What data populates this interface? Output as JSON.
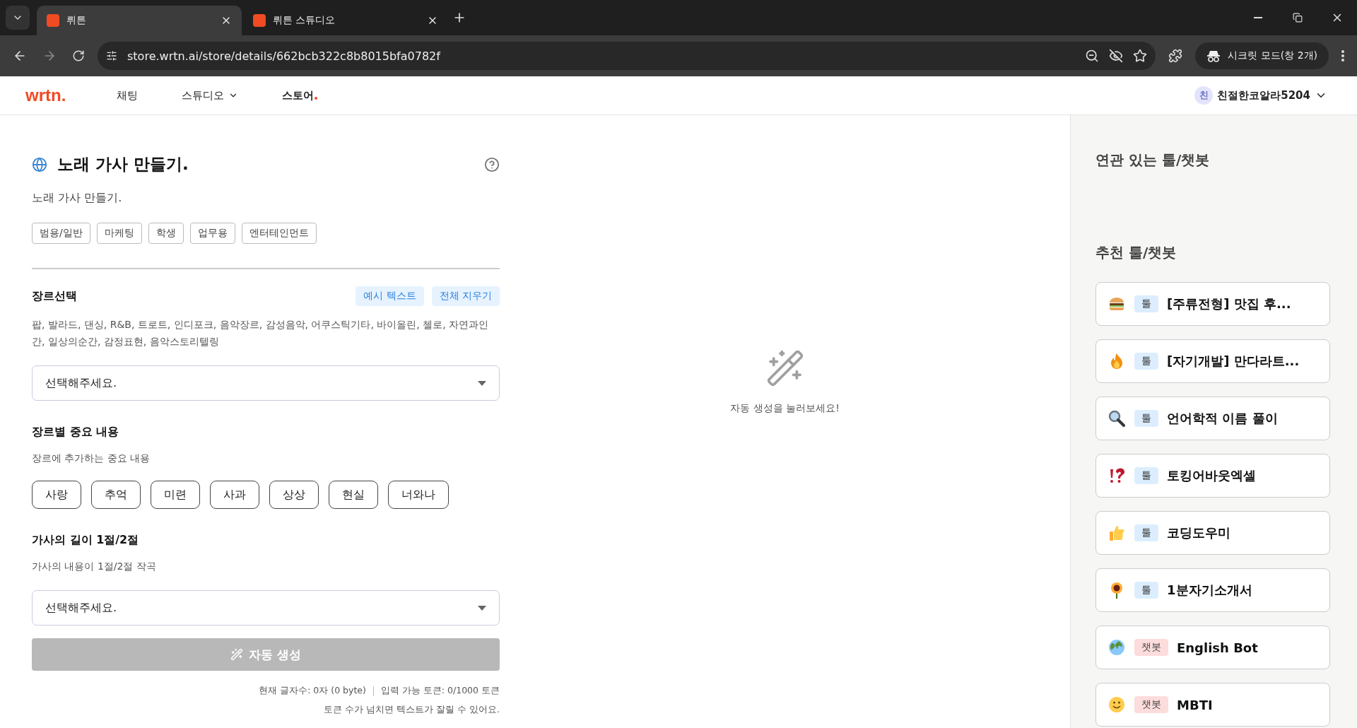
{
  "browser": {
    "tabs": [
      {
        "title": "뤼튼",
        "selected": true
      },
      {
        "title": "뤼튼 스튜디오",
        "selected": false
      }
    ],
    "url": "store.wrtn.ai/store/details/662bcb322c8b8015bfa0782f",
    "profile": "시크릿 모드(창 2개)"
  },
  "nav": {
    "logo": "wrtn.",
    "items": [
      {
        "label": "채팅",
        "selected": false,
        "dropdown": false
      },
      {
        "label": "스튜디오",
        "selected": false,
        "dropdown": true
      },
      {
        "label": "스토어",
        "selected": true,
        "dropdown": false
      }
    ],
    "user": {
      "avatar": "친",
      "name": "친절한코알라5204"
    }
  },
  "tool": {
    "title": "노래 가사 만들기.",
    "description": "노래 가사 만들기.",
    "tags": [
      "범용/일반",
      "마케팅",
      "학생",
      "업무용",
      "엔터테인먼트"
    ],
    "fields": [
      {
        "kind": "select",
        "label": "장르선택",
        "actions": [
          "예시 텍스트",
          "전체 지우기"
        ],
        "hint": "팝, 발라드, 댄싱, R&B, 트로트, 인디포크, 음악장르, 감성음악, 어쿠스틱기타, 바이올린, 첼로, 자연과인간, 일상의순간, 감정표현, 음악스토리텔링",
        "placeholder": "선택해주세요."
      },
      {
        "kind": "chips",
        "label": "장르별 중요 내용",
        "hint": "장르에 추가하는 중요 내용",
        "options": [
          {
            "label": "사랑",
            "selected": false
          },
          {
            "label": "추억",
            "selected": false
          },
          {
            "label": "미련",
            "selected": false
          },
          {
            "label": "사과",
            "selected": false
          },
          {
            "label": "상상",
            "selected": false
          },
          {
            "label": "현실",
            "selected": false
          },
          {
            "label": "너와나",
            "selected": false
          }
        ]
      },
      {
        "kind": "select",
        "label": "가사의 길이 1절/2절",
        "hint": "가사의 내용이 1절/2절 작곡",
        "placeholder": "선택해주세요."
      }
    ],
    "generate": {
      "label": "자동 생성",
      "disabled": true
    },
    "counter": "현재 글자수: 0자 (0 byte)",
    "tokens": "입력 가능 토큰: 0/1000 토큰",
    "warning": "토큰 수가 넘치면 텍스트가 잘릴 수 있어요."
  },
  "result": {
    "empty_message": "자동 생성을 눌러보세요!"
  },
  "sidebar": {
    "related_title": "연관 있는 툴/챗봇",
    "recommended_title": "추천 툴/챗봇",
    "items": [
      {
        "kind": "tool",
        "badge": "툴",
        "title": "[주류전형] 맛집 후..."
      },
      {
        "kind": "tool",
        "badge": "툴",
        "title": "[자기개발] 만다라트..."
      },
      {
        "kind": "tool",
        "badge": "툴",
        "title": "언어학적 이름 풀이"
      },
      {
        "kind": "tool",
        "badge": "툴",
        "title": "토킹어바웃엑셀"
      },
      {
        "kind": "tool",
        "badge": "툴",
        "title": "코딩도우미"
      },
      {
        "kind": "tool",
        "badge": "툴",
        "title": "1분자기소개서"
      },
      {
        "kind": "chatbot",
        "badge": "챗봇",
        "title": "English Bot"
      },
      {
        "kind": "chatbot",
        "badge": "챗봇",
        "title": "MBTI"
      }
    ]
  }
}
